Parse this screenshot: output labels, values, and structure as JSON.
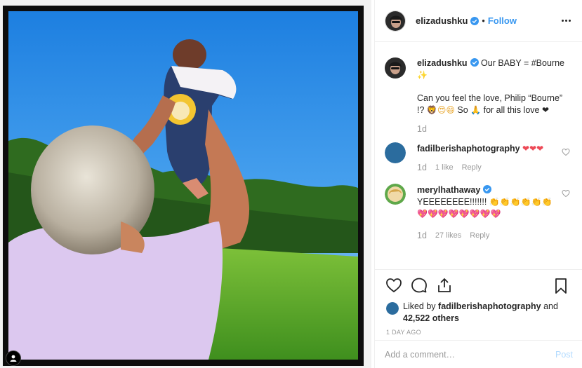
{
  "post": {
    "author": "elizadushku",
    "separator": "•",
    "follow_label": "Follow"
  },
  "caption": {
    "username": "elizadushku",
    "text_line1": "Our BABY = #Bourne",
    "text_line1_emoji": "✨",
    "text_line2": "Can you feel the love, Philip “Bourne” !?",
    "text_line2_emoji": "🦁😍😄",
    "text_line2b": "So",
    "text_line2_emoji2": "🙏",
    "text_line2c": "for all this love",
    "text_line2_heart": "❤",
    "time": "1d"
  },
  "comments": [
    {
      "username": "fadilberishaphotography",
      "text": "",
      "emoji": "❤❤❤",
      "time": "1d",
      "likes": "1 like",
      "reply": "Reply"
    },
    {
      "username": "merylhathaway",
      "text": "YEEEEEEEE!!!!!!!",
      "emoji": "👏👏👏👏👏👏",
      "emoji2": "💖💖💖💖💖💖💖💖",
      "time": "1d",
      "likes": "27 likes",
      "reply": "Reply"
    }
  ],
  "likes": {
    "prefix": "Liked by",
    "user": "fadilberishaphotography",
    "and": "and",
    "count": "42,522 others"
  },
  "time_ago": "1 DAY AGO",
  "add_comment": {
    "placeholder": "Add a comment…",
    "post_label": "Post"
  },
  "colors": {
    "link": "#3897f0",
    "verified": "#3897f0",
    "heart": "#ed4956"
  }
}
